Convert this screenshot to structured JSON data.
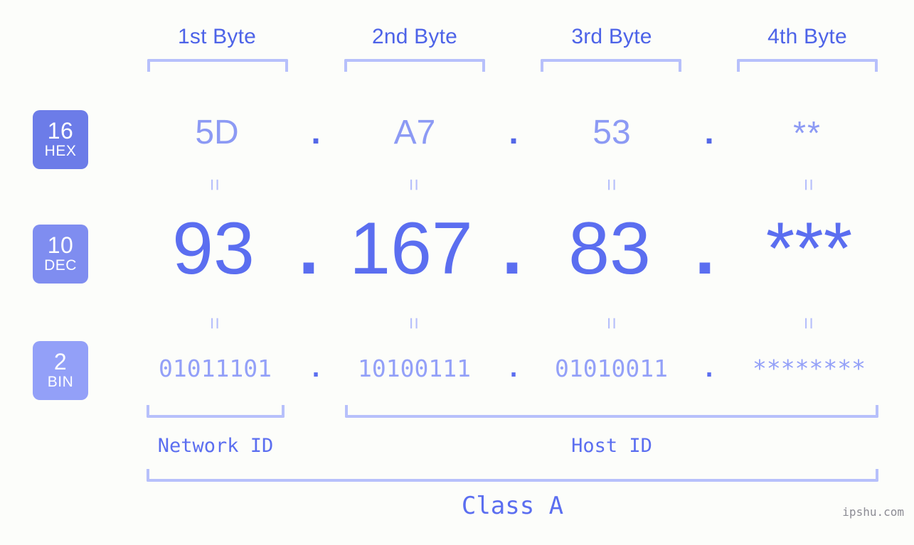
{
  "meta": {
    "background_color": "#fcfdfa",
    "accent_color": "#5b6ef0",
    "bracket_color": "#b7c0fb",
    "watermark": "ipshu.com"
  },
  "headers": {
    "bytes": [
      {
        "label": "1st Byte"
      },
      {
        "label": "2nd Byte"
      },
      {
        "label": "3rd Byte"
      },
      {
        "label": "4th Byte"
      }
    ]
  },
  "bases": [
    {
      "id": "hex",
      "number": "16",
      "name": "HEX",
      "color": "#6c7ce8"
    },
    {
      "id": "dec",
      "number": "10",
      "name": "DEC",
      "color": "#7f8df0"
    },
    {
      "id": "bin",
      "number": "2",
      "name": "BIN",
      "color": "#93a0f8"
    }
  ],
  "rows": {
    "hex": {
      "values": [
        "5D",
        "A7",
        "53",
        "**"
      ],
      "separators": [
        ".",
        ".",
        "."
      ]
    },
    "dec": {
      "values": [
        "93",
        "167",
        "83",
        "***"
      ],
      "separators": [
        ".",
        ".",
        "."
      ]
    },
    "bin": {
      "values": [
        "01011101",
        "10100111",
        "01010011",
        "********"
      ],
      "separators": [
        ".",
        ".",
        "."
      ]
    }
  },
  "equals": {
    "glyph": "=",
    "row1": [
      "=",
      "=",
      "=",
      "="
    ],
    "row2": [
      "=",
      "=",
      "=",
      "="
    ]
  },
  "sections": {
    "network_id": "Network ID",
    "host_id": "Host ID",
    "class": "Class A"
  }
}
